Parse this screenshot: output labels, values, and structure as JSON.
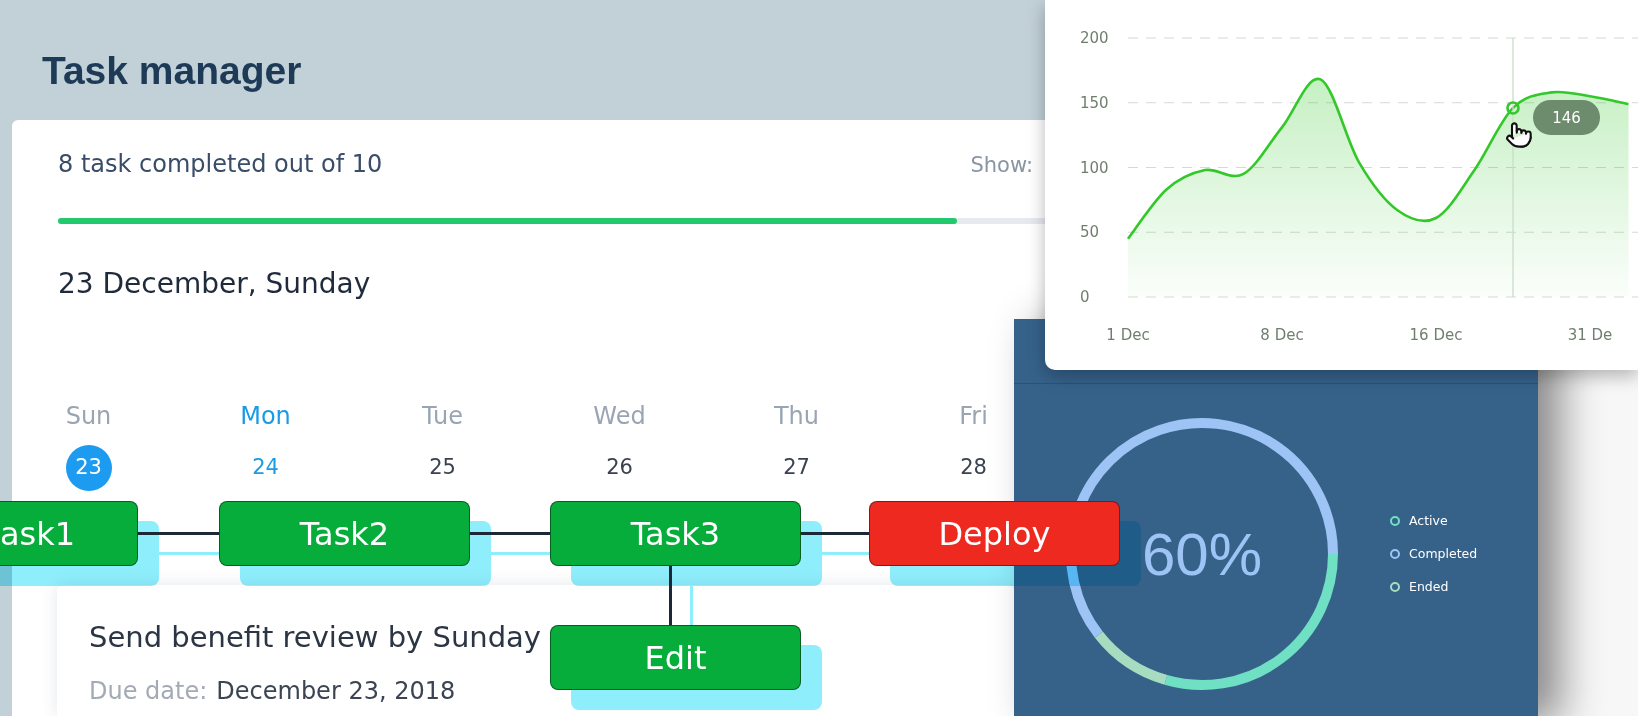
{
  "page": {
    "title": "Task manager"
  },
  "progress": {
    "summary": "8 task completed out of 10",
    "show_label": "Show:",
    "level": 0.91
  },
  "calendar": {
    "date_heading": "23 December, Sunday",
    "days": [
      {
        "weekday": "Sun",
        "date": "23",
        "selected": true,
        "highlighted": false
      },
      {
        "weekday": "Mon",
        "date": "24",
        "selected": false,
        "highlighted": true
      },
      {
        "weekday": "Tue",
        "date": "25",
        "selected": false,
        "highlighted": false
      },
      {
        "weekday": "Wed",
        "date": "26",
        "selected": false,
        "highlighted": false
      },
      {
        "weekday": "Thu",
        "date": "27",
        "selected": false,
        "highlighted": false
      },
      {
        "weekday": "Fri",
        "date": "28",
        "selected": false,
        "highlighted": false
      }
    ]
  },
  "task_card": {
    "title": "Send benefit review by Sunday",
    "due_label": "Due date:",
    "due_value": "December 23, 2018"
  },
  "flow_diagram": {
    "chain": [
      {
        "label": "ask1",
        "color": "#07ad3a"
      },
      {
        "label": "Task2",
        "color": "#07ad3a"
      },
      {
        "label": "Task3",
        "color": "#07ad3a",
        "branches": [
          {
            "label": "Edit",
            "color": "#07ad3a"
          }
        ]
      },
      {
        "label": "Deploy",
        "color": "#ee2a20"
      }
    ]
  },
  "status_panel": {
    "center_label": "60%",
    "legend": [
      {
        "label": "Active",
        "color": "#6fe0c4"
      },
      {
        "label": "Completed",
        "color": "#9dc4f5"
      },
      {
        "label": "Ended",
        "color": "#a8dcc0"
      }
    ]
  },
  "line_chart": {
    "chart_data": {
      "type": "area",
      "categories": [
        "1 Dec",
        null,
        null,
        null,
        "8 Dec",
        null,
        null,
        null,
        "16 Dec",
        null,
        null,
        null,
        "31 De",
        null
      ],
      "series": [
        {
          "color": "#33c82a",
          "values": [
            45,
            83,
            98,
            95,
            131,
            168,
            104,
            67,
            61,
            98,
            146,
            158,
            155,
            149
          ]
        }
      ],
      "ylim": [
        0,
        200
      ],
      "yticks": [
        0,
        50,
        100,
        150,
        200
      ],
      "grid": true,
      "annotations": [
        "146"
      ]
    }
  }
}
